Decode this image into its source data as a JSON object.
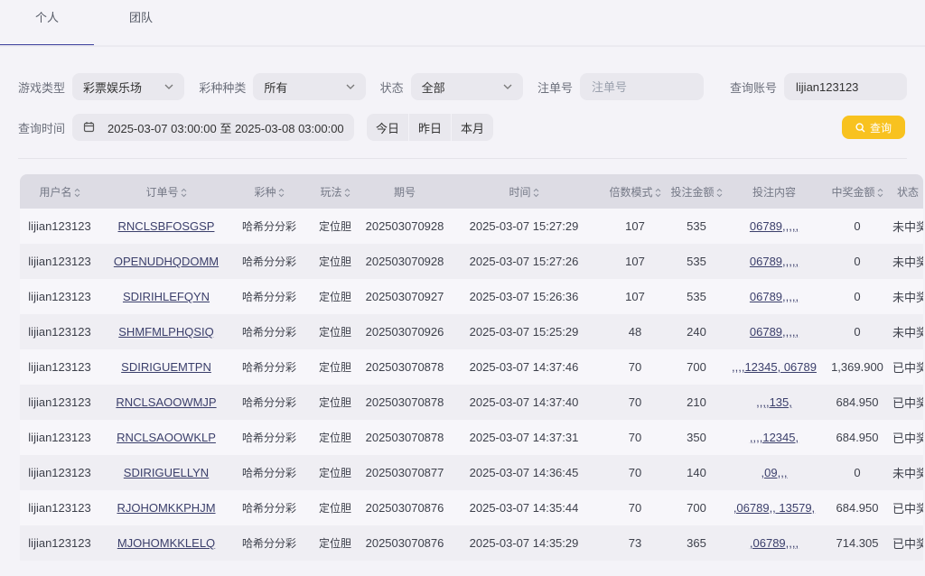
{
  "tabs": [
    {
      "label": "个人",
      "active": true
    },
    {
      "label": "团队",
      "active": false
    }
  ],
  "filters": {
    "game_type_label": "游戏类型",
    "game_type_value": "彩票娱乐场",
    "lottery_type_label": "彩种种类",
    "lottery_type_value": "所有",
    "status_label": "状态",
    "status_value": "全部",
    "order_no_label": "注单号",
    "order_no_placeholder": "注单号",
    "account_label": "查询账号",
    "account_value": "lijian123123",
    "time_label": "查询时间",
    "time_range": "2025-03-07 03:00:00 至 2025-03-08 03:00:00",
    "quick": [
      "今日",
      "昨日",
      "本月"
    ],
    "search_label": "查询"
  },
  "colors": {
    "accent": "#3b3f9c",
    "search_button": "#f8c21f",
    "header_bg": "#dddce4"
  },
  "table": {
    "columns": [
      {
        "label": "用户名",
        "sortable": true
      },
      {
        "label": "订单号",
        "sortable": true
      },
      {
        "label": "彩种",
        "sortable": true
      },
      {
        "label": "玩法",
        "sortable": true
      },
      {
        "label": "期号",
        "sortable": false
      },
      {
        "label": "时间",
        "sortable": true
      },
      {
        "label": "倍数模式",
        "sortable": true
      },
      {
        "label": "投注金额",
        "sortable": true
      },
      {
        "label": "投注内容",
        "sortable": false
      },
      {
        "label": "中奖金额",
        "sortable": true
      },
      {
        "label": "状态",
        "sortable": false
      }
    ],
    "rows": [
      [
        "lijian123123",
        "RNCLSBFOSGSP",
        "哈希分分彩",
        "定位胆",
        "202503070928",
        "2025-03-07 15:27:29",
        "107",
        "535",
        "06789,,,,,",
        "0",
        "未中奖"
      ],
      [
        "lijian123123",
        "OPENUDHQDOMM",
        "哈希分分彩",
        "定位胆",
        "202503070928",
        "2025-03-07 15:27:26",
        "107",
        "535",
        "06789,,,,,",
        "0",
        "未中奖"
      ],
      [
        "lijian123123",
        "SDIRIHLEFQYN",
        "哈希分分彩",
        "定位胆",
        "202503070927",
        "2025-03-07 15:26:36",
        "107",
        "535",
        "06789,,,,,",
        "0",
        "未中奖"
      ],
      [
        "lijian123123",
        "SHMFMLPHQSIQ",
        "哈希分分彩",
        "定位胆",
        "202503070926",
        "2025-03-07 15:25:29",
        "48",
        "240",
        "06789,,,,,",
        "0",
        "未中奖"
      ],
      [
        "lijian123123",
        "SDIRIGUEMTPN",
        "哈希分分彩",
        "定位胆",
        "202503070878",
        "2025-03-07 14:37:46",
        "70",
        "700",
        ",,,,12345, 06789",
        "1,369.900",
        "已中奖"
      ],
      [
        "lijian123123",
        "RNCLSAOOWMJP",
        "哈希分分彩",
        "定位胆",
        "202503070878",
        "2025-03-07 14:37:40",
        "70",
        "210",
        ",,,,135,",
        "684.950",
        "已中奖"
      ],
      [
        "lijian123123",
        "RNCLSAOOWKLP",
        "哈希分分彩",
        "定位胆",
        "202503070878",
        "2025-03-07 14:37:31",
        "70",
        "350",
        ",,,,12345,",
        "684.950",
        "已中奖"
      ],
      [
        "lijian123123",
        "SDIRIGUELLYN",
        "哈希分分彩",
        "定位胆",
        "202503070877",
        "2025-03-07 14:36:45",
        "70",
        "140",
        ",09,,,",
        "0",
        "未中奖"
      ],
      [
        "lijian123123",
        "RJOHOMKKPHJM",
        "哈希分分彩",
        "定位胆",
        "202503070876",
        "2025-03-07 14:35:44",
        "70",
        "700",
        ",06789,, 13579,",
        "684.950",
        "已中奖"
      ],
      [
        "lijian123123",
        "MJOHOMKKLELQ",
        "哈希分分彩",
        "定位胆",
        "202503070876",
        "2025-03-07 14:35:29",
        "73",
        "365",
        ",06789,,,,",
        "714.305",
        "已中奖"
      ]
    ]
  }
}
